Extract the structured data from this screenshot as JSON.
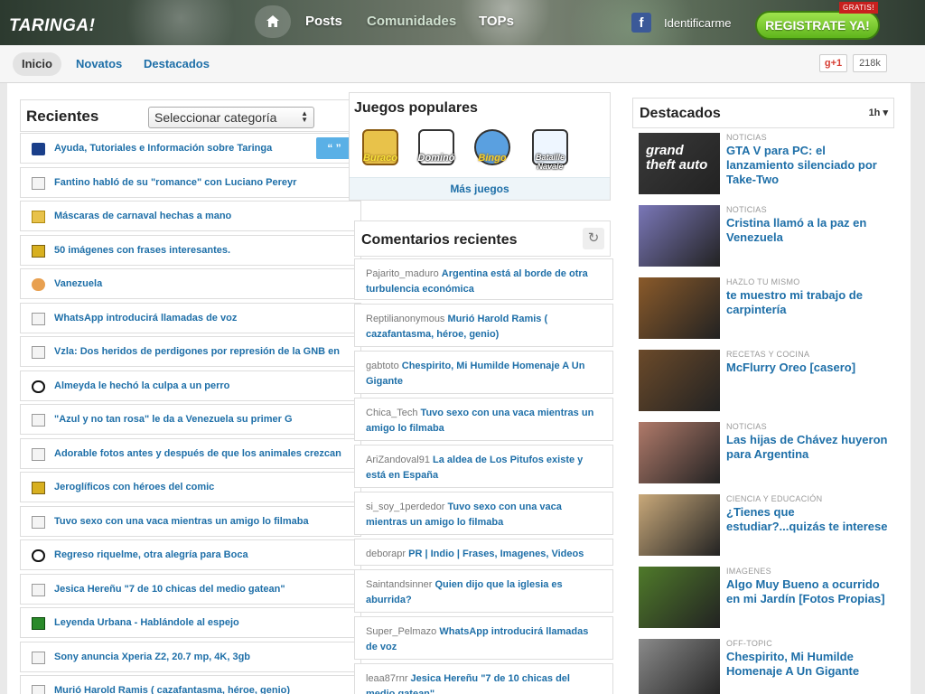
{
  "header": {
    "logo": "TARINGA!",
    "nav": [
      "Posts",
      "Comunidades",
      "TOPs"
    ],
    "login": "Identificarme",
    "register": "REGISTRATE YA!",
    "gratis": "GRATIS!",
    "facebook_glyph": "f"
  },
  "subnav": {
    "tabs": [
      "Inicio",
      "Novatos",
      "Destacados"
    ],
    "gplus": "g+1",
    "gplus_count": "218k"
  },
  "recientes": {
    "title": "Recientes",
    "category_select": "Seleccionar categoría",
    "quote_button": "“ ”",
    "items": [
      {
        "icon": "info-icon",
        "text": "Ayuda, Tutoriales e Información sobre Taringa"
      },
      {
        "icon": "document-icon",
        "text": "Fantino habló de su \"romance\" con Luciano Pereyr"
      },
      {
        "icon": "art-icon",
        "text": "Máscaras de carnaval hechas a mano"
      },
      {
        "icon": "image-icon",
        "text": "50 imágenes con frases interesantes."
      },
      {
        "icon": "palette-icon",
        "text": "Vanezuela"
      },
      {
        "icon": "document-icon",
        "text": "WhatsApp introducirá llamadas de voz"
      },
      {
        "icon": "document-icon",
        "text": "Vzla: Dos heridos de perdigones por represión de la GNB en"
      },
      {
        "icon": "soccer-icon",
        "text": "Almeyda le hechó la culpa a un perro"
      },
      {
        "icon": "document-icon",
        "text": "\"Azul y no tan rosa\" le da a Venezuela su primer G"
      },
      {
        "icon": "document-icon",
        "text": "Adorable fotos antes y después de que los animales crezcan"
      },
      {
        "icon": "image-icon",
        "text": "Jeroglíficos con héroes del comic"
      },
      {
        "icon": "document-icon",
        "text": "Tuvo sexo con una vaca mientras un amigo lo filmaba"
      },
      {
        "icon": "soccer-icon",
        "text": "Regreso riquelme, otra alegría para Boca"
      },
      {
        "icon": "document-icon",
        "text": "Jesica Hereñu \"7 de 10 chicas del medio gatean\""
      },
      {
        "icon": "film-icon",
        "text": "Leyenda Urbana - Hablándole al espejo"
      },
      {
        "icon": "document-icon",
        "text": "Sony anuncia Xperia Z2, 20.7 mp, 4K, 3gb"
      },
      {
        "icon": "document-icon",
        "text": "Murió Harold Ramis ( cazafantasma, héroe, genio)"
      }
    ]
  },
  "juegos": {
    "title": "Juegos populares",
    "games": [
      "Buraco",
      "Dominó",
      "Bingo",
      "Bataille Navale"
    ],
    "more": "Más juegos"
  },
  "comentarios": {
    "title": "Comentarios recientes",
    "refresh_glyph": "↻",
    "items": [
      {
        "user": "Pajarito_maduro",
        "title": "Argentina está al borde de otra turbulencia económica"
      },
      {
        "user": "Reptilianonymous",
        "title": "Murió Harold Ramis ( cazafantasma, héroe, genio)"
      },
      {
        "user": "gabtoto",
        "title": "Chespirito, Mi Humilde Homenaje A Un Gigante"
      },
      {
        "user": "Chica_Tech",
        "title": "Tuvo sexo con una vaca mientras un amigo lo filmaba"
      },
      {
        "user": "AriZandoval91",
        "title": "La aldea de Los Pitufos existe y está en España"
      },
      {
        "user": "si_soy_1perdedor",
        "title": "Tuvo sexo con una vaca mientras un amigo lo filmaba"
      },
      {
        "user": "deborapr",
        "title": "PR | Indio | Frases, Imagenes, Videos"
      },
      {
        "user": "Saintandsinner",
        "title": "Quien dijo que la iglesia es aburrida?"
      },
      {
        "user": "Super_Pelmazo",
        "title": "WhatsApp introducirá llamadas de voz"
      },
      {
        "user": "leaa87rnr",
        "title": "Jesica Hereñu \"7 de 10 chicas del medio gatean\""
      }
    ]
  },
  "destacados": {
    "title": "Destacados",
    "period": "1h",
    "items": [
      {
        "category": "Noticias",
        "title": "GTA V para PC: el lanzamiento silenciado por Take-Two",
        "color": "#3a3a3a",
        "thumb_text": "grand theft auto"
      },
      {
        "category": "Noticias",
        "title": "Cristina llamó a la paz en Venezuela",
        "color": "#7a77b8",
        "thumb_text": ""
      },
      {
        "category": "Hazlo tu mismo",
        "title": "te muestro mi trabajo de carpintería",
        "color": "#8a5a2a",
        "thumb_text": ""
      },
      {
        "category": "Recetas y Cocina",
        "title": "McFlurry Oreo [casero]",
        "color": "#6b4a2a",
        "thumb_text": ""
      },
      {
        "category": "Noticias",
        "title": "Las hijas de Chávez huyeron para Argentina",
        "color": "#b07a6a",
        "thumb_text": ""
      },
      {
        "category": "Ciencia y Educación",
        "title": "¿Tienes que estudiar?...quizás te interese",
        "color": "#c9a97a",
        "thumb_text": ""
      },
      {
        "category": "Imagenes",
        "title": "Algo Muy Bueno a ocurrido en mi Jardín [Fotos Propias]",
        "color": "#4f7a2a",
        "thumb_text": ""
      },
      {
        "category": "Off-Topic",
        "title": "Chespirito, Mi Humilde Homenaje A Un Gigante",
        "color": "#8a8a8a",
        "thumb_text": ""
      }
    ]
  }
}
